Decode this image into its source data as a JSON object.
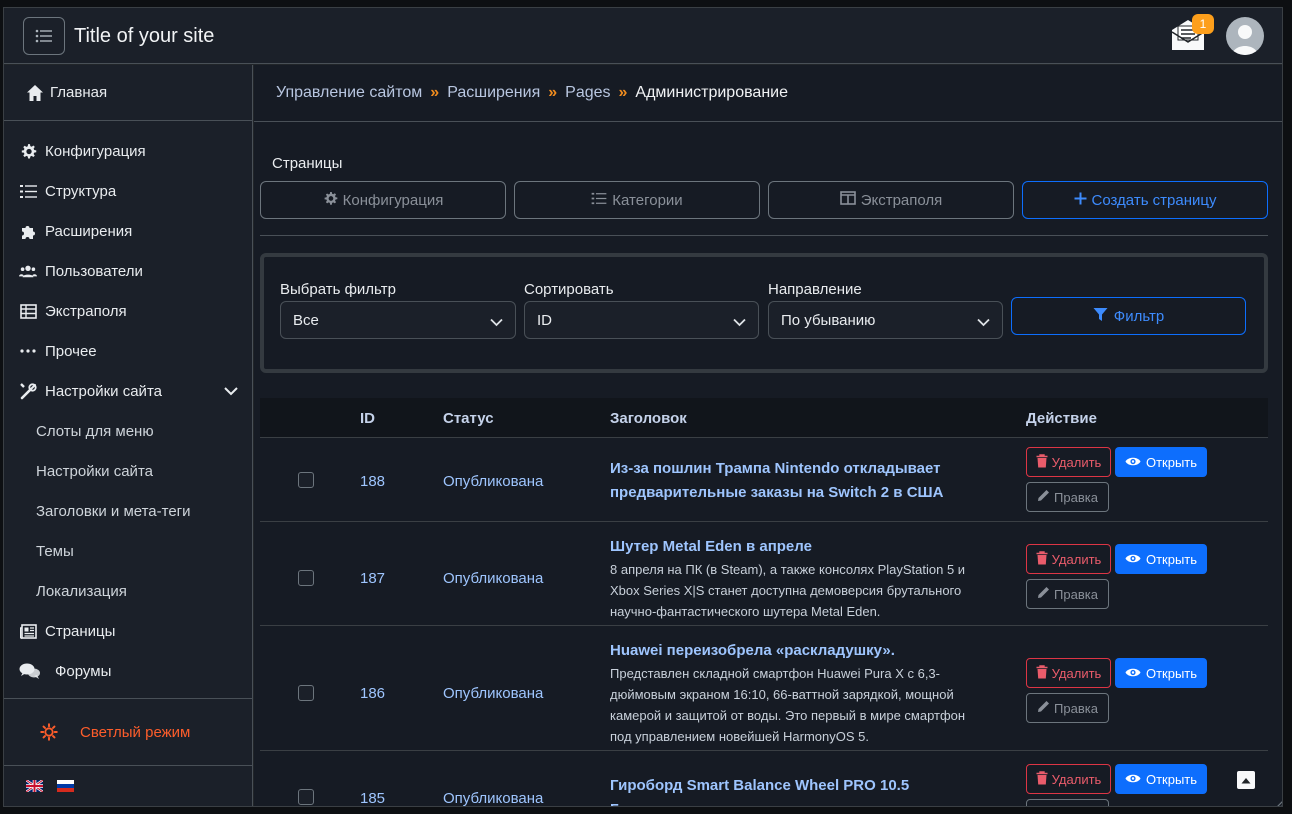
{
  "header": {
    "site_title": "Title of your site",
    "notifications_count": "1"
  },
  "sidebar": {
    "home": "Главная",
    "items": [
      {
        "label": "Конфигурация",
        "icon": "gear-icon"
      },
      {
        "label": "Структура",
        "icon": "list-icon"
      },
      {
        "label": "Расширения",
        "icon": "puzzle-icon"
      },
      {
        "label": "Пользователи",
        "icon": "users-icon"
      },
      {
        "label": "Экстраполя",
        "icon": "table-icon"
      },
      {
        "label": "Прочее",
        "icon": "dots-icon"
      },
      {
        "label": "Настройки сайта",
        "icon": "tools-icon"
      }
    ],
    "subitems": [
      "Слоты для меню",
      "Настройки сайта",
      "Заголовки и мета-теги",
      "Темы",
      "Локализация"
    ],
    "bottom_items": [
      {
        "label": "Страницы",
        "icon": "newspaper-icon"
      },
      {
        "label": "Форумы",
        "icon": "chat-icon"
      }
    ],
    "theme_toggle": "Светлый режим"
  },
  "breadcrumb": [
    "Управление сайтом",
    "Расширения",
    "Pages",
    "Администрирование"
  ],
  "page": {
    "heading": "Страницы",
    "toolbar": {
      "config": "Конфигурация",
      "categories": "Категории",
      "extrafields": "Экстраполя",
      "create": "Создать страницу"
    }
  },
  "filters": {
    "filter_label": "Выбрать фильтр",
    "filter_value": "Все",
    "sort_label": "Сортировать",
    "sort_value": "ID",
    "direction_label": "Направление",
    "direction_value": "По убыванию",
    "filter_button": "Фильтр"
  },
  "table": {
    "columns": [
      "ID",
      "Статус",
      "Заголовок",
      "Действие"
    ],
    "delete_label": "Удалить",
    "open_label": "Открыть",
    "edit_label": "Правка",
    "rows": [
      {
        "id": "188",
        "status": "Опубликована",
        "title_lines": [
          "Из-за пошлин Трампа Nintendo откладывает",
          "предварительные заказы на Switch 2 в США"
        ],
        "desc_lines": []
      },
      {
        "id": "187",
        "status": "Опубликована",
        "title_lines": [
          "Шутер Metal Eden в апреле"
        ],
        "desc_lines": [
          "8 апреля на ПК (в Steam), а также консолях PlayStation 5 и",
          "Xbox Series X|S станет доступна демоверсия брутального",
          "научно-фантастического шутера Metal Eden."
        ]
      },
      {
        "id": "186",
        "status": "Опубликована",
        "title_lines": [
          "Huawei переизобрела «раскладушку»."
        ],
        "desc_lines": [
          "Представлен складной смартфон Huawei Pura X с 6,3-",
          "дюймовым экраном 16:10, 66-ваттной зарядкой, мощной",
          "камерой и защитой от воды. Это первый в мире смартфон",
          "под управлением новейшей HarmonyOS 5."
        ]
      },
      {
        "id": "185",
        "status": "Опубликована",
        "title_lines": [
          "Гироборд Smart Balance Wheel PRO 10.5",
          "Галактика"
        ],
        "desc_lines": []
      }
    ]
  },
  "colors": {
    "accent": "#0d6efd",
    "danger": "#dc3545",
    "breadcrumb_sep": "#f08c1e",
    "theme_toggle": "#fd5d2b",
    "badge": "#fd9f1b"
  }
}
